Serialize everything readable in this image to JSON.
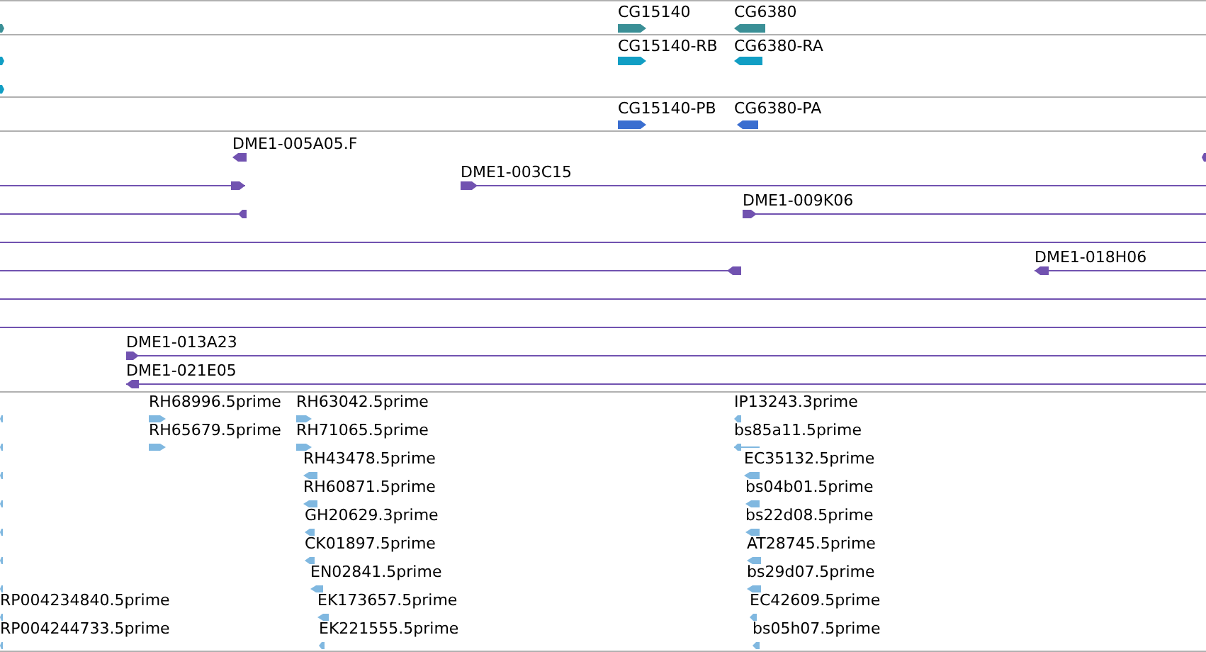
{
  "tracks": [
    {
      "kind": "gene",
      "features": [
        {
          "reverse": false
        },
        {
          "label": "CG15140",
          "reverse": false
        },
        {
          "label": "CG6380",
          "reverse": true
        }
      ]
    },
    {
      "kind": "transcript",
      "features": [
        {
          "reverse": false
        },
        {
          "label": "CG15140-RB",
          "reverse": false
        },
        {
          "label": "CG6380-RA",
          "reverse": true
        },
        {
          "reverse": false
        }
      ]
    },
    {
      "kind": "protein",
      "features": [
        {
          "label": "CG15140-PB",
          "reverse": false
        },
        {
          "label": "CG6380-PA",
          "reverse": true
        }
      ]
    },
    {
      "kind": "clone",
      "features": [
        {
          "kind": "arrow",
          "label": "DME1-005A05.F",
          "reverse": true
        },
        {
          "kind": "arrow",
          "reverse": true
        },
        {
          "kind": "arrow",
          "reverse": false
        },
        {
          "kind": "arrow",
          "label": "DME1-003C15",
          "reverse": false
        },
        {
          "kind": "arrow",
          "reverse": true
        },
        {
          "kind": "arrow",
          "label": "DME1-009K06",
          "reverse": false
        },
        {
          "kind": "line"
        },
        {
          "kind": "arrow",
          "reverse": true
        },
        {
          "kind": "arrow",
          "label": "DME1-018H06",
          "reverse": true
        },
        {
          "kind": "line"
        },
        {
          "kind": "line"
        },
        {
          "kind": "arrow",
          "label": "DME1-013A23",
          "reverse": false
        },
        {
          "kind": "arrow",
          "label": "DME1-021E05",
          "reverse": true
        }
      ]
    },
    {
      "kind": "est",
      "features": [
        {
          "reverse": true
        },
        {
          "label": "RH68996.5prime",
          "reverse": false
        },
        {
          "label": "RH63042.5prime",
          "reverse": false
        },
        {
          "label": "IP13243.3prime",
          "reverse": true
        },
        {
          "reverse": true
        },
        {
          "label": "RH65679.5prime",
          "reverse": false
        },
        {
          "label": "RH71065.5prime",
          "reverse": false
        },
        {
          "label": "bs85a11.5prime",
          "reverse": true
        },
        {
          "reverse": true
        },
        {
          "label": "RH43478.5prime",
          "reverse": true
        },
        {
          "label": "EC35132.5prime",
          "reverse": true
        },
        {
          "reverse": true
        },
        {
          "label": "RH60871.5prime",
          "reverse": true
        },
        {
          "label": "bs04b01.5prime",
          "reverse": true
        },
        {
          "reverse": true
        },
        {
          "label": "GH20629.3prime",
          "reverse": true
        },
        {
          "label": "bs22d08.5prime",
          "reverse": true
        },
        {
          "reverse": true
        },
        {
          "label": "CK01897.5prime",
          "reverse": true
        },
        {
          "label": "AT28745.5prime",
          "reverse": true
        },
        {
          "reverse": true
        },
        {
          "label": "EN02841.5prime",
          "reverse": true
        },
        {
          "label": "bs29d07.5prime",
          "reverse": true
        },
        {
          "label": "RP004234840.5prime",
          "reverse": true
        },
        {
          "label": "EK173657.5prime",
          "reverse": true
        },
        {
          "label": "EC42609.5prime",
          "reverse": true
        },
        {
          "label": "RP004244733.5prime",
          "reverse": true
        },
        {
          "label": "EK221555.5prime",
          "reverse": true
        },
        {
          "label": "bs05h07.5prime",
          "reverse": true
        }
      ]
    }
  ]
}
